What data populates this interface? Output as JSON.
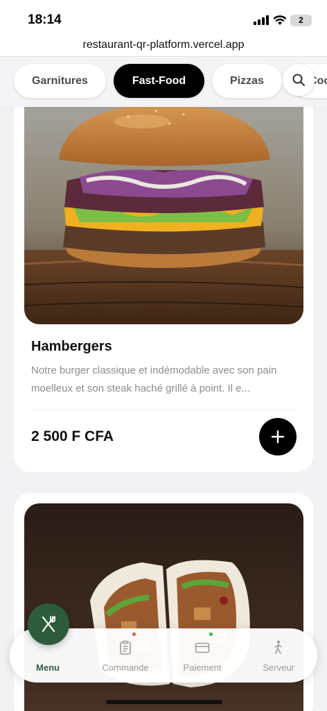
{
  "status_bar": {
    "time": "18:14",
    "battery": "2"
  },
  "browser": {
    "url": "restaurant-qr-platform.vercel.app"
  },
  "categories": [
    {
      "label": "Garnitures",
      "active": false
    },
    {
      "label": "Fast-Food",
      "active": true
    },
    {
      "label": "Pizzas",
      "active": false
    },
    {
      "label": "Coc",
      "active": false
    }
  ],
  "items": [
    {
      "name": "Hambergers",
      "description": "Notre burger classique et indémodable avec son pain moelleux et son steak haché grillé à point. Il e...",
      "price": "2 500 F CFA",
      "image": "burger"
    },
    {
      "image": "wrap"
    }
  ],
  "bottom_nav": {
    "items": [
      {
        "label": "Menu",
        "icon": "utensils-icon",
        "active": true
      },
      {
        "label": "Commande",
        "icon": "clipboard-icon",
        "active": false,
        "dot_color": "#e05a4f"
      },
      {
        "label": "Paiement",
        "icon": "credit-card-icon",
        "active": false,
        "dot_color": "#2eb85c"
      },
      {
        "label": "Serveur",
        "icon": "waiter-icon",
        "active": false
      }
    ]
  },
  "colors": {
    "accent_green": "#2c5c3c",
    "chip_active": "#000000"
  }
}
